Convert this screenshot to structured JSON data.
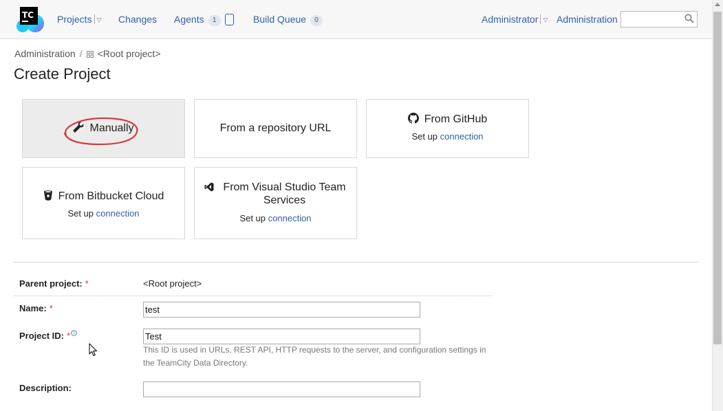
{
  "header": {
    "logo_text": "TC",
    "nav": {
      "projects": "Projects",
      "changes": "Changes",
      "agents": "Agents",
      "agents_count": "1",
      "build_queue": "Build Queue",
      "build_queue_count": "0",
      "user": "Administrator",
      "administration": "Administration"
    },
    "search": {
      "value": "",
      "placeholder": ""
    }
  },
  "breadcrumb": {
    "root": "Administration",
    "separator": "/",
    "current": "<Root project>"
  },
  "page_title": "Create Project",
  "options": {
    "manually": "Manually",
    "repo_url": "From a repository URL",
    "github": "From GitHub",
    "bitbucket": "From Bitbucket Cloud",
    "vsts": "From Visual Studio Team Services",
    "setup_text": "Set up",
    "connection_link": "connection"
  },
  "form": {
    "parent_project_label": "Parent project:",
    "parent_project_value": "<Root project>",
    "name_label": "Name:",
    "name_value": "test",
    "project_id_label": "Project ID:",
    "project_id_value": "Test",
    "project_id_note": "This ID is used in URLs, REST API, HTTP requests to the server, and configuration settings in the TeamCity Data Directory.",
    "description_label": "Description:",
    "description_value": "",
    "required_mark": "*"
  },
  "colors": {
    "link": "#2f5fa8",
    "highlight": "#d9393a",
    "selected_tile": "#ececec"
  }
}
